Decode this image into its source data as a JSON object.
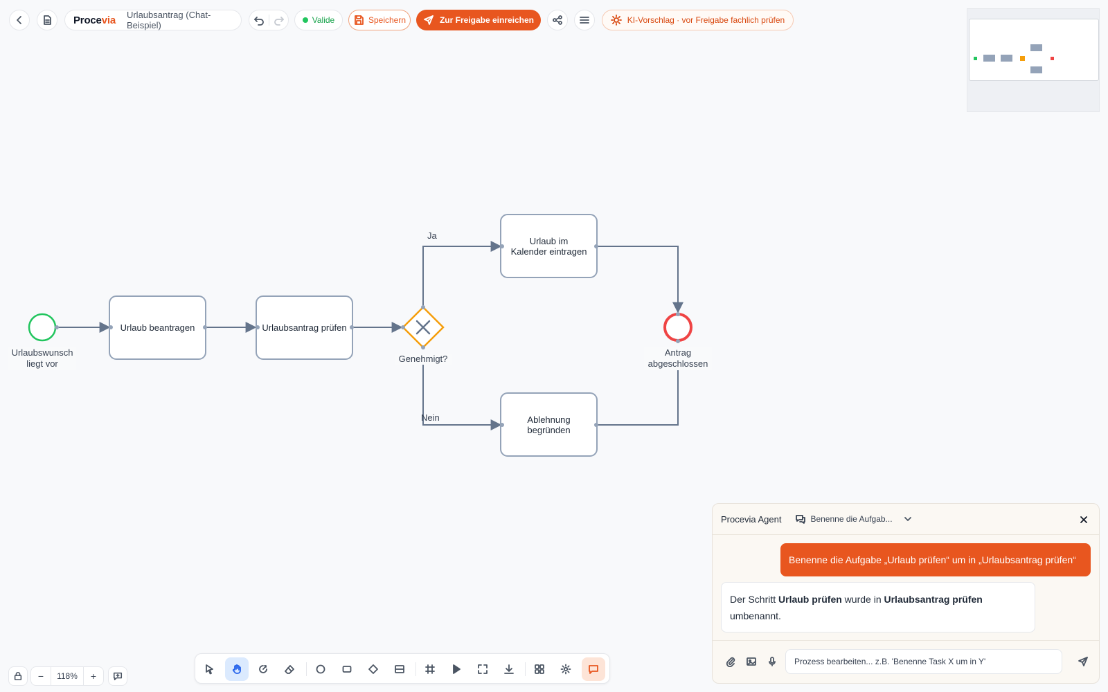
{
  "header": {
    "brand_part1": "Proce",
    "brand_part2": "via",
    "document_title": "Urlaubsantrag (Chat-Beispiel)",
    "status_label": "Valide",
    "save_label": "Speichern",
    "submit_label": "Zur Freigabe einreichen",
    "ai_note": "KI-Vorschlag · vor Freigabe fachlich prüfen"
  },
  "process": {
    "start_event": "Urlaubswunsch liegt vor",
    "task_request": "Urlaub beantragen",
    "task_review": "Urlaubsantrag prüfen",
    "gateway": "Genehmigt?",
    "task_calendar": "Urlaub im Kalender eintragen",
    "task_reject": "Ablehnung begründen",
    "end_event": "Antrag abgeschlossen",
    "edge_yes": "Ja",
    "edge_no": "Nein"
  },
  "chat": {
    "title": "Procevia Agent",
    "thread_title": "Benenne die Aufgab...",
    "user_message": "Benenne die Aufgabe „Urlaub prüfen“ um in „Urlaubsantrag prüfen“",
    "agent_part1": "Der Schritt ",
    "agent_bold1": "Urlaub prüfen",
    "agent_part2": " wurde in ",
    "agent_bold2": "Urlaubsantrag prüfen",
    "agent_part3": " umbenannt.",
    "input_placeholder": "Prozess bearbeiten... z.B. 'Benenne Task X um in Y'"
  },
  "zoom": {
    "level": "118%",
    "minus": "−",
    "plus": "+"
  },
  "colors": {
    "accent": "#e8561f",
    "valid": "#22c55e",
    "start_event": "#22c55e",
    "end_event": "#ef4444",
    "gateway": "#f59e0b",
    "edge": "#64748b"
  },
  "icons": {
    "toolbar": [
      "pointer-icon",
      "hand-icon",
      "lasso-icon",
      "eraser-icon",
      "circle-icon",
      "rectangle-icon",
      "diamond-icon",
      "pool-icon",
      "grid-icon",
      "play-icon",
      "fit-screen-icon",
      "download-icon",
      "apps-icon",
      "settings-icon",
      "chat-icon"
    ]
  }
}
